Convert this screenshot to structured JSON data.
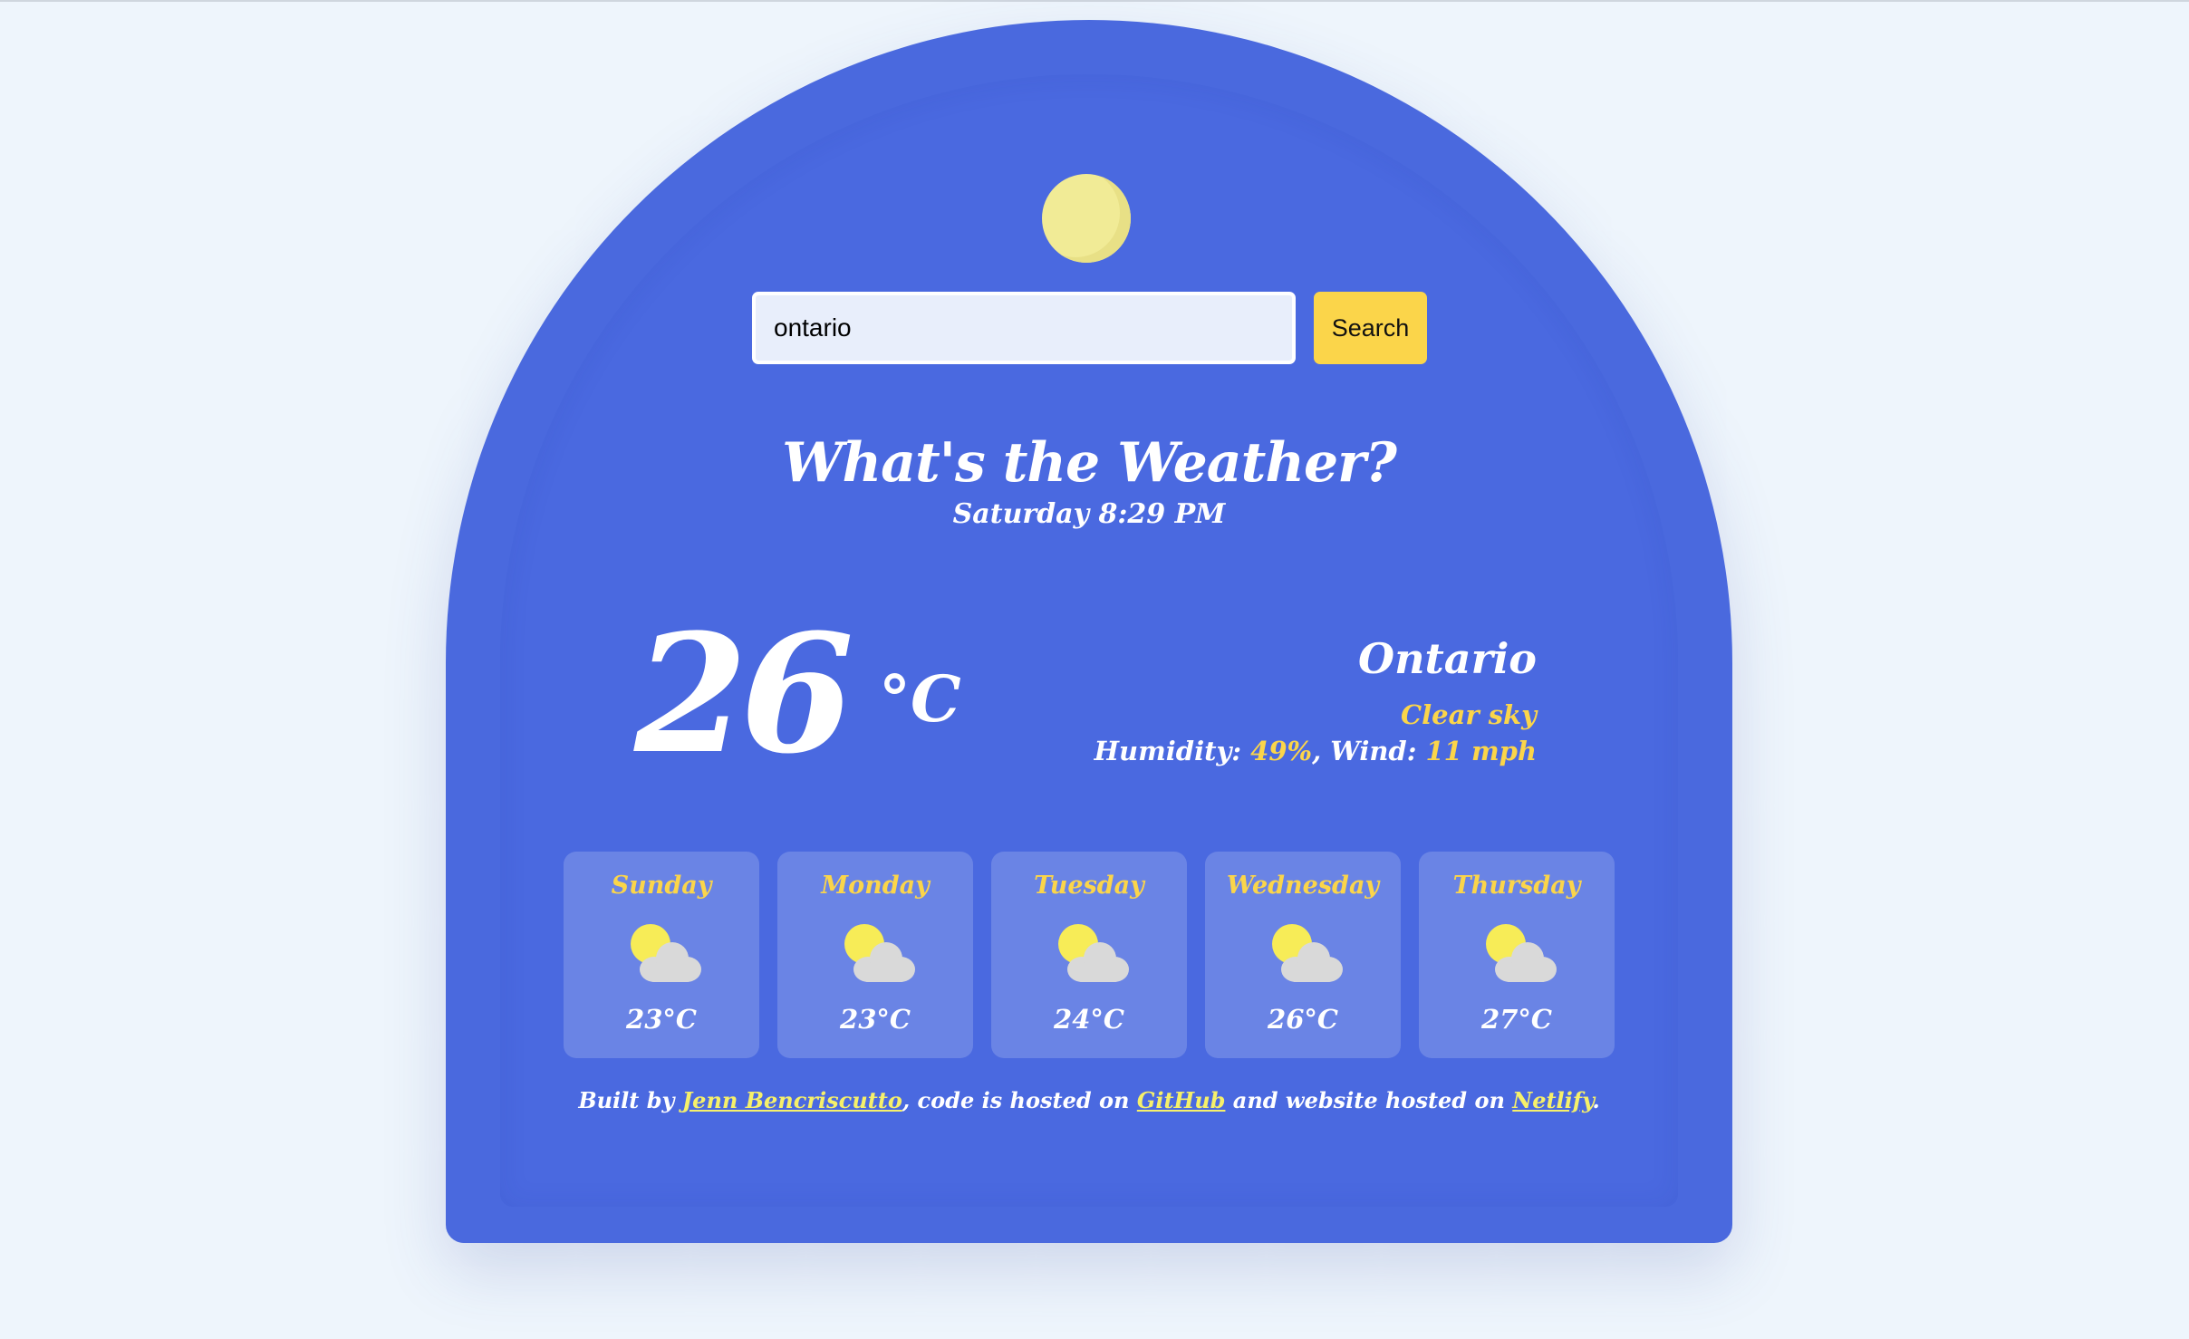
{
  "search": {
    "value": "ontario",
    "button_label": "Search"
  },
  "header": {
    "title": "What's the Weather?",
    "datetime": "Saturday 8:29 PM"
  },
  "current": {
    "temperature": "26",
    "unit": "°C",
    "city": "Ontario",
    "description": "Clear sky",
    "humidity_label": "Humidity: ",
    "humidity_value": "49%",
    "wind_label": ", Wind: ",
    "wind_value": "11 mph"
  },
  "forecast": [
    {
      "day": "Sunday",
      "temp": "23°C",
      "icon": "partly-cloudy-icon"
    },
    {
      "day": "Monday",
      "temp": "23°C",
      "icon": "partly-cloudy-icon"
    },
    {
      "day": "Tuesday",
      "temp": "24°C",
      "icon": "partly-cloudy-icon"
    },
    {
      "day": "Wednesday",
      "temp": "26°C",
      "icon": "partly-cloudy-icon"
    },
    {
      "day": "Thursday",
      "temp": "27°C",
      "icon": "partly-cloudy-icon"
    }
  ],
  "footer": {
    "prefix": "Built by ",
    "author_link": "Jenn Bencriscutto",
    "middle1": ", code is hosted on ",
    "github_link": "GitHub",
    "middle2": " and website hosted on ",
    "netlify_link": "Netlify",
    "suffix": "."
  },
  "colors": {
    "background": "#eef5fc",
    "card": "#4a69de",
    "accent": "#fbd54a",
    "moon": "#f1eb96",
    "link": "#f6f06a"
  }
}
